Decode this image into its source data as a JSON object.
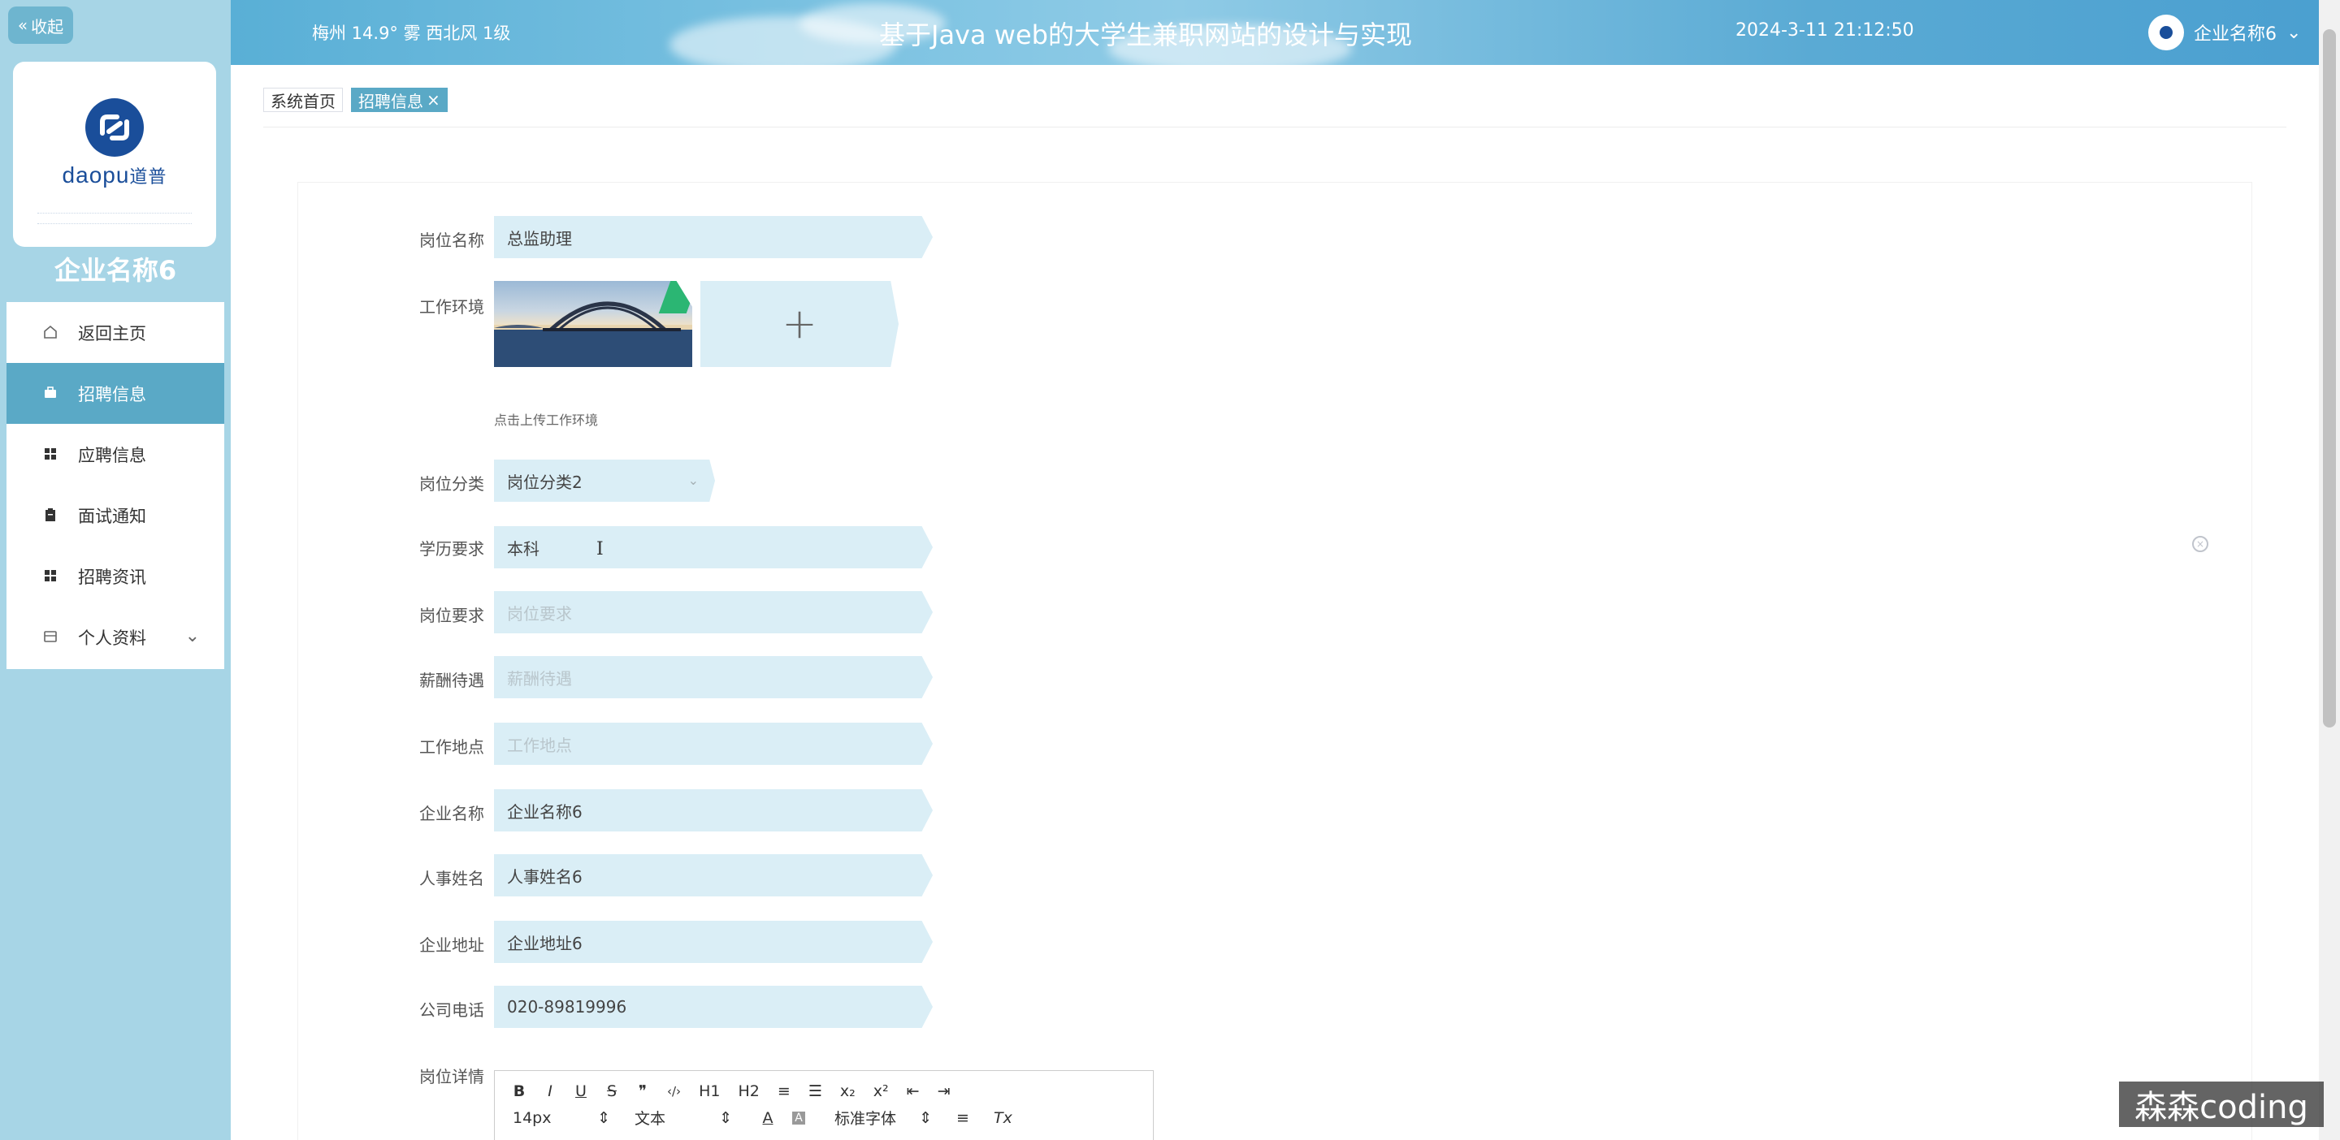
{
  "sidebar": {
    "collapse_label": "收起",
    "logo_brand": "daopu",
    "logo_brand_cn": "道普",
    "company_title": "企业名称6",
    "menu": [
      {
        "label": "返回主页",
        "icon": "home-icon"
      },
      {
        "label": "招聘信息",
        "icon": "briefcase-icon",
        "active": true
      },
      {
        "label": "应聘信息",
        "icon": "grid-icon"
      },
      {
        "label": "面试通知",
        "icon": "clipboard-icon"
      },
      {
        "label": "招聘资讯",
        "icon": "grid-icon"
      },
      {
        "label": "个人资料",
        "icon": "card-icon",
        "has_submenu": true
      }
    ]
  },
  "header": {
    "weather": "梅州 14.9° 雾 西北风 1级",
    "title": "基于Java web的大学生兼职网站的设计与实现",
    "datetime": "2024-3-11 21:12:50",
    "user_name": "企业名称6"
  },
  "tabs": [
    {
      "label": "系统首页"
    },
    {
      "label": "招聘信息",
      "active": true,
      "closable": true
    }
  ],
  "form": {
    "job_name": {
      "label": "岗位名称",
      "value": "总监助理"
    },
    "work_env": {
      "label": "工作环境",
      "upload_hint": "点击上传工作环境",
      "plus": "+"
    },
    "job_category": {
      "label": "岗位分类",
      "value": "岗位分类2"
    },
    "education": {
      "label": "学历要求",
      "value": "本科"
    },
    "job_requirements": {
      "label": "岗位要求",
      "placeholder": "岗位要求"
    },
    "salary": {
      "label": "薪酬待遇",
      "placeholder": "薪酬待遇"
    },
    "work_location": {
      "label": "工作地点",
      "placeholder": "工作地点"
    },
    "company_name": {
      "label": "企业名称",
      "value": "企业名称6"
    },
    "hr_name": {
      "label": "人事姓名",
      "value": "人事姓名6"
    },
    "company_address": {
      "label": "企业地址",
      "value": "企业地址6"
    },
    "company_phone": {
      "label": "公司电话",
      "value": "020-89819996"
    },
    "job_details": {
      "label": "岗位详情"
    }
  },
  "editor_toolbar": {
    "row1": [
      "B",
      "I",
      "U",
      "S",
      "❞",
      "‹/›",
      "H1",
      "H2",
      "≡",
      "☰",
      "x₂",
      "x²",
      "⇤",
      "⇥"
    ],
    "font_size": "14px",
    "text_type": "文本",
    "font_family": "标准字体",
    "clear_format": "Tx"
  },
  "watermark": "森森coding",
  "colors": {
    "sidebar_bg": "#a7d5e6",
    "accent": "#5aa9c6",
    "input_bg": "#daeef6"
  }
}
